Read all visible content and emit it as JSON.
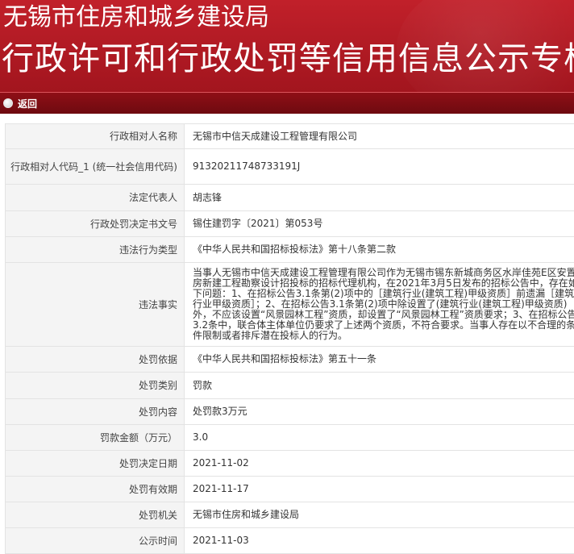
{
  "header": {
    "title": "无锡市住房和城乡建设局",
    "subtitle": "行政许可和行政处罚等信用信息公示专栏"
  },
  "nav": {
    "back_label": "返回"
  },
  "rows": [
    {
      "label": "行政相对人名称",
      "value": "无锡市中信天成建设工程管理有限公司"
    },
    {
      "label": "行政相对人代码_1 (统一社会信用代码)",
      "value": "91320211748733191J"
    },
    {
      "label": "法定代表人",
      "value": "胡志锋"
    },
    {
      "label": "行政处罚决定书文号",
      "value": "锡住建罚字〔2021〕第053号"
    },
    {
      "label": "违法行为类型",
      "value": "《中华人民共和国招标投标法》第十八条第二款"
    },
    {
      "label": "违法事实",
      "value": "当事人无锡市中信天成建设工程管理有限公司作为无锡市锡东新城商务区水岸佳苑E区安置房新建工程勘察设计招投标的招标代理机构，在2021年3月5日发布的招标公告中，存在如下问题：1、在招标公告3.1条第(2)项中的［建筑行业(建筑工程)甲级资质］前遗漏［建筑行业甲级资质］；2、在招标公告3.1条第(2)项中除设置了(建筑行业(建筑工程)甲级资质)外，不应该设置“风景园林工程”资质，却设置了“风景园林工程”资质要求；3、在招标公告3.2条中，联合体主体单位仍要求了上述两个资质，不符合要求。当事人存在以不合理的条件限制或者排斥潜在投标人的行为。"
    },
    {
      "label": "处罚依据",
      "value": "《中华人民共和国招标投标法》第五十一条"
    },
    {
      "label": "处罚类别",
      "value": "罚款"
    },
    {
      "label": "处罚内容",
      "value": "处罚款3万元"
    },
    {
      "label": "罚款金额（万元）",
      "value": "3.0"
    },
    {
      "label": "处罚决定日期",
      "value": "2021-11-02"
    },
    {
      "label": "处罚有效期",
      "value": "2021-11-17"
    },
    {
      "label": "处罚机关",
      "value": "无锡市住房和城乡建设局"
    },
    {
      "label": "公示时间",
      "value": "2021-11-03"
    }
  ]
}
